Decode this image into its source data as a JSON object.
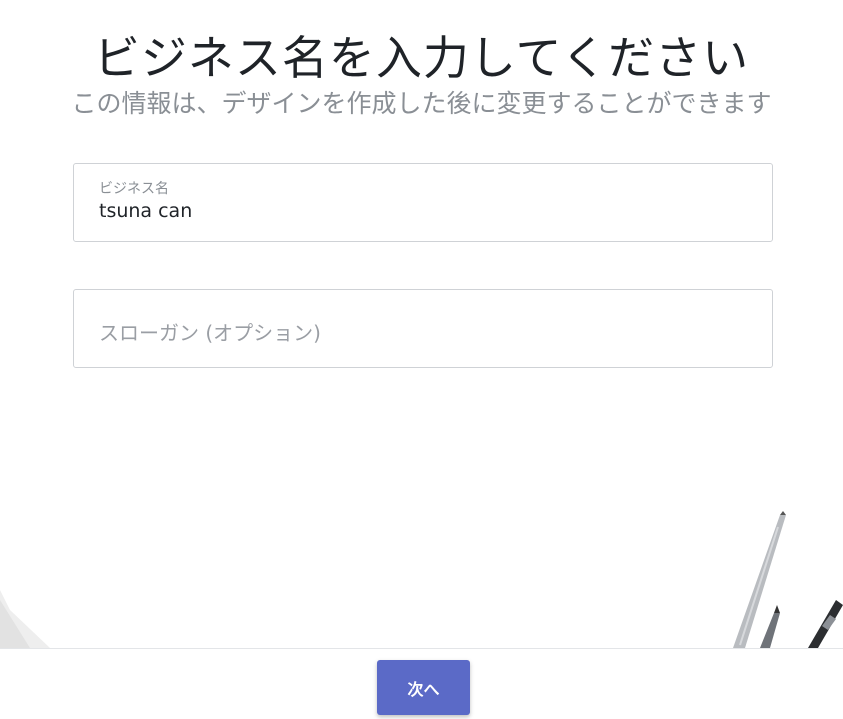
{
  "header": {
    "title": "ビジネス名を入力してください",
    "subtitle": "この情報は、デザインを作成した後に変更することができます"
  },
  "form": {
    "business_name": {
      "label": "ビジネス名",
      "value": "tsuna can"
    },
    "slogan": {
      "placeholder": "スローガン (オプション)"
    }
  },
  "footer": {
    "next_label": "次へ"
  },
  "colors": {
    "accent": "#5b6ac7",
    "title_text": "#1f2328",
    "muted_text": "#8a8f95",
    "border": "#cfd2d6"
  }
}
